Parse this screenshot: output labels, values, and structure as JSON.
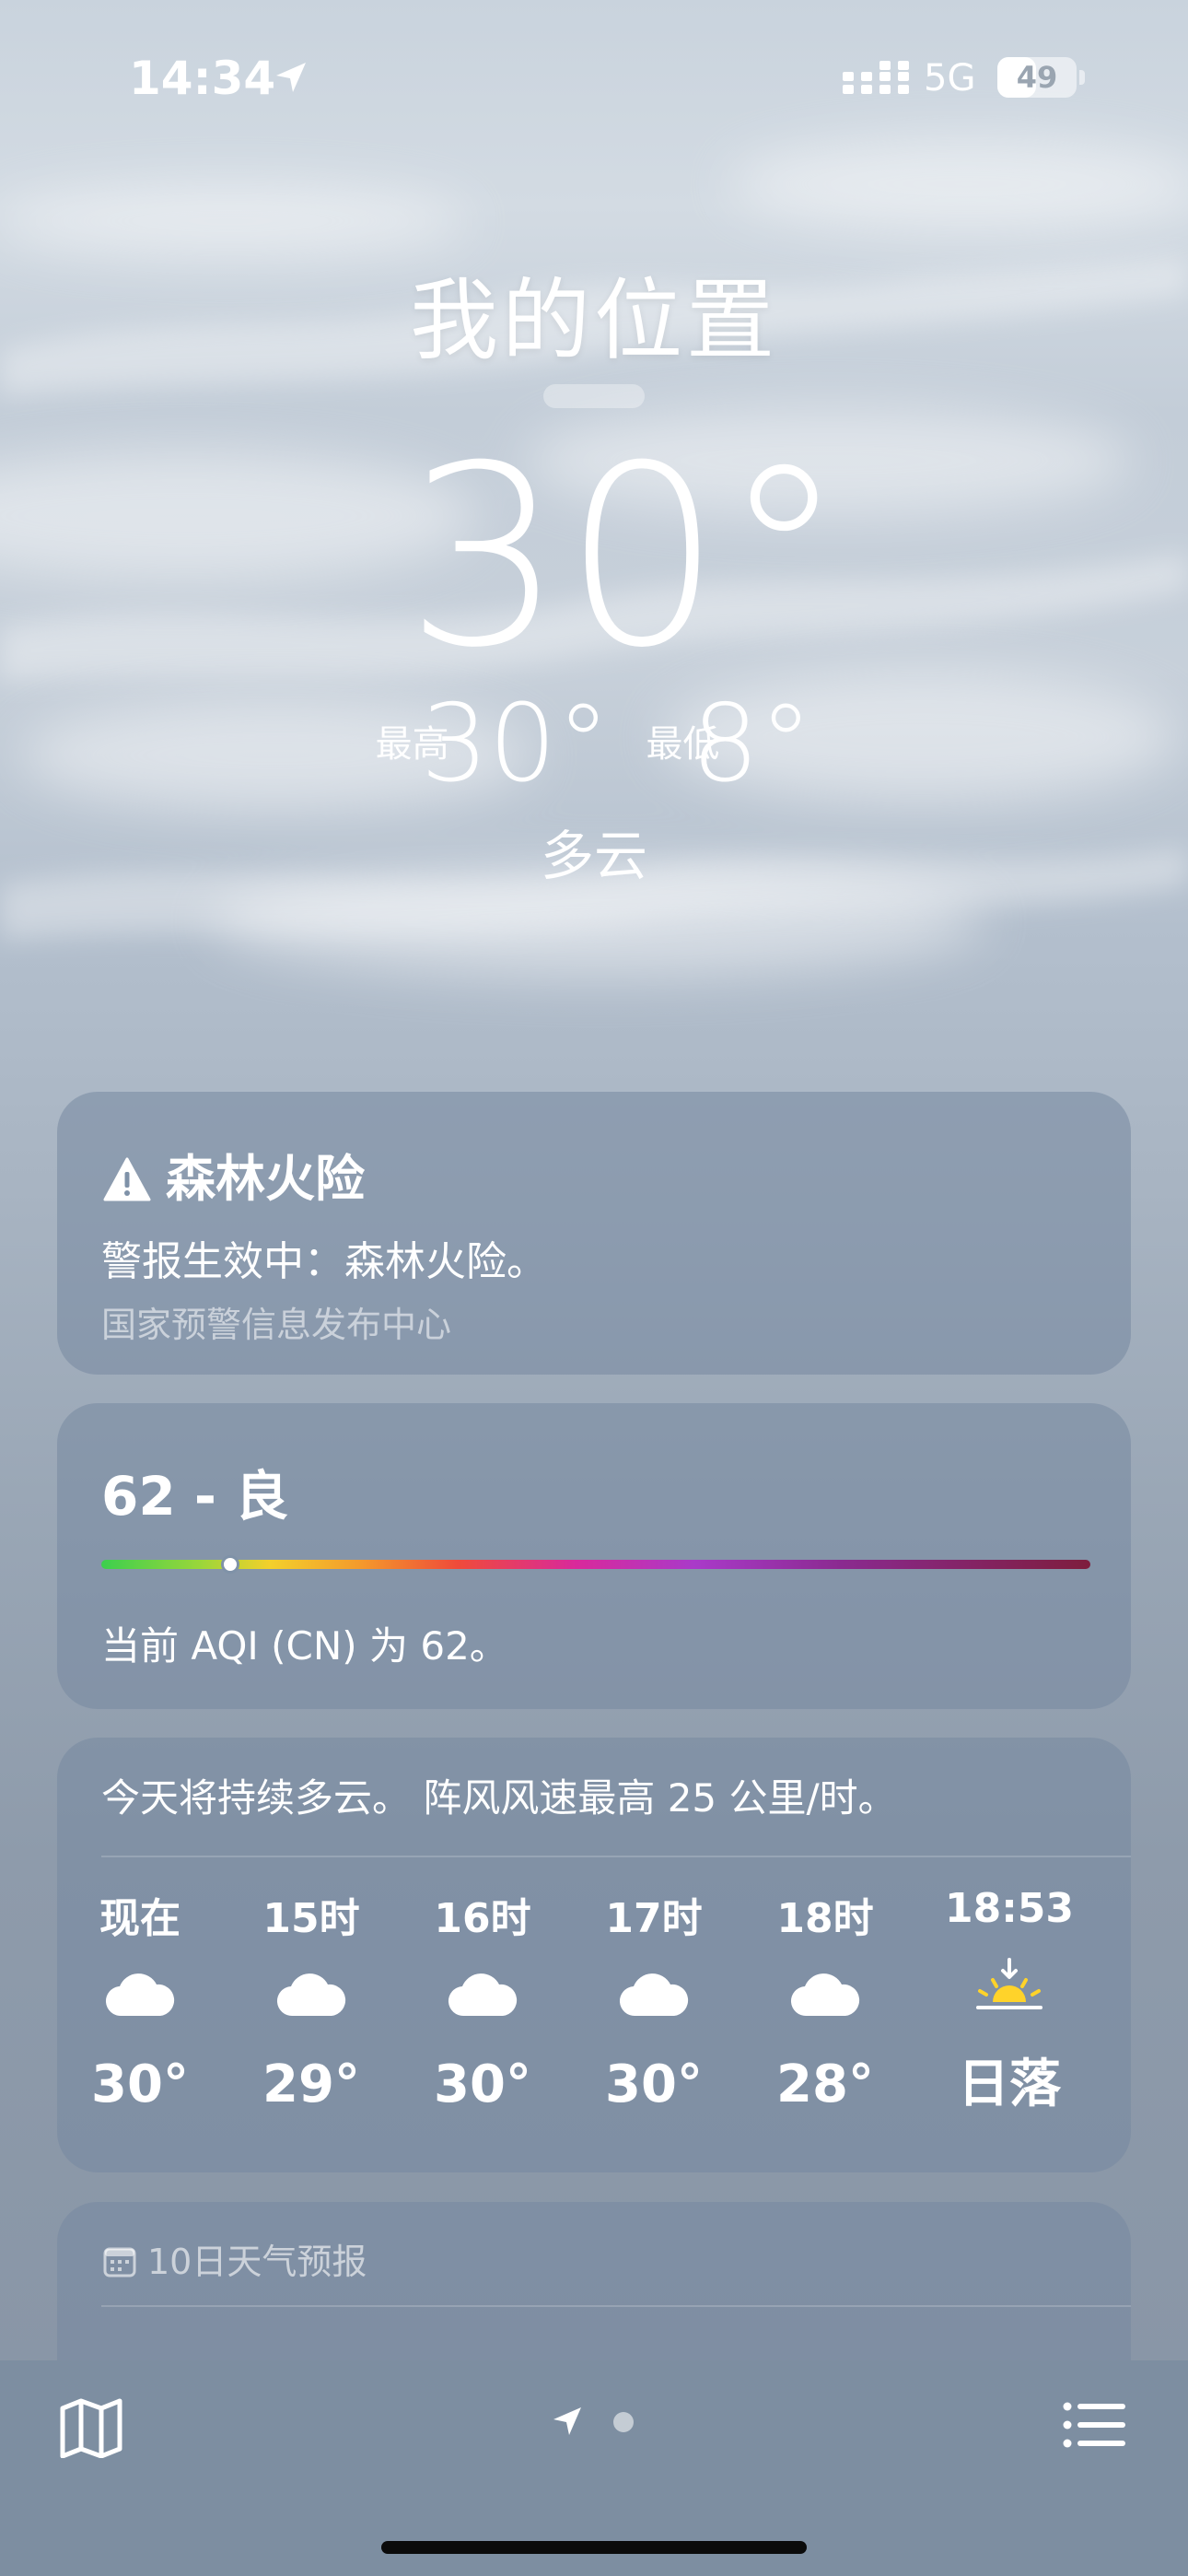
{
  "status_bar": {
    "time": "14:34",
    "network": "5G",
    "battery_level": "49",
    "battery_fraction": 0.49
  },
  "header": {
    "location": "我的位置",
    "temperature": "30°",
    "high_label": "最高",
    "high": "30°",
    "low_label": "最低",
    "low": "8°",
    "condition": "多云"
  },
  "alert": {
    "title": "森林火险",
    "body": "警报生效中：森林火险。",
    "source": "国家预警信息发布中心",
    "icon": "warning-triangle-icon"
  },
  "aqi": {
    "value_text": "62 - 良",
    "description": "当前 AQI (CN) 为 62。",
    "level_fraction": 0.13
  },
  "hourly": {
    "summary": "今天将持续多云。 阵风风速最高 25 公里/时。",
    "items": [
      {
        "label": "现在",
        "icon": "cloud-icon",
        "temp": "30°"
      },
      {
        "label": "15时",
        "icon": "cloud-icon",
        "temp": "29°"
      },
      {
        "label": "16时",
        "icon": "cloud-icon",
        "temp": "30°"
      },
      {
        "label": "17时",
        "icon": "cloud-icon",
        "temp": "30°"
      },
      {
        "label": "18时",
        "icon": "cloud-icon",
        "temp": "28°"
      },
      {
        "label": "18:53",
        "icon": "sunset-icon",
        "temp": "日落"
      }
    ]
  },
  "ten_day": {
    "title": "10日天气预报",
    "icon": "calendar-icon"
  },
  "toolbar": {
    "left_icon": "map-icon",
    "center_icon": "location-arrow-icon",
    "right_icon": "list-icon"
  }
}
